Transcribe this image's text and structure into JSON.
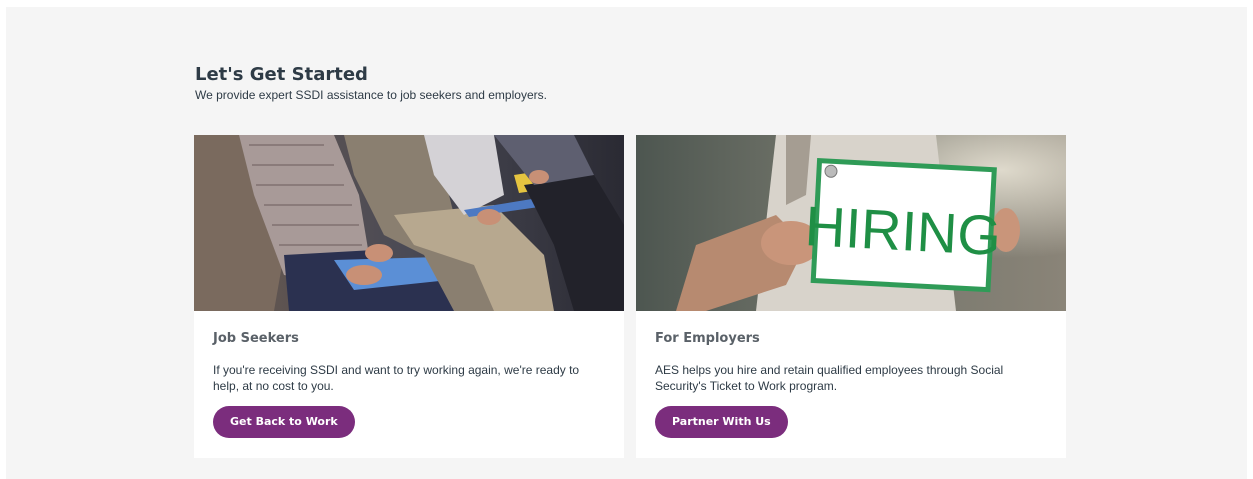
{
  "section": {
    "title": "Let's Get Started",
    "subtitle": "We provide expert SSDI assistance to job seekers and employers."
  },
  "cards": [
    {
      "title": "Job Seekers",
      "text": "If you're receiving SSDI and want to try working again, we're ready to help, at no cost to you.",
      "button_label": "Get Back to Work",
      "image_subject": "people-seated-with-folders-photo"
    },
    {
      "title": "For Employers",
      "text": "AES helps you hire and retain qualified employees through Social Security's Ticket to Work program.",
      "button_label": "Partner With Us",
      "image_subject": "hiring-sign-photo",
      "image_sign_text": "HIRING"
    }
  ],
  "colors": {
    "button": "#7b2d7d",
    "background": "#f5f5f5",
    "heading": "#2e3b46"
  }
}
